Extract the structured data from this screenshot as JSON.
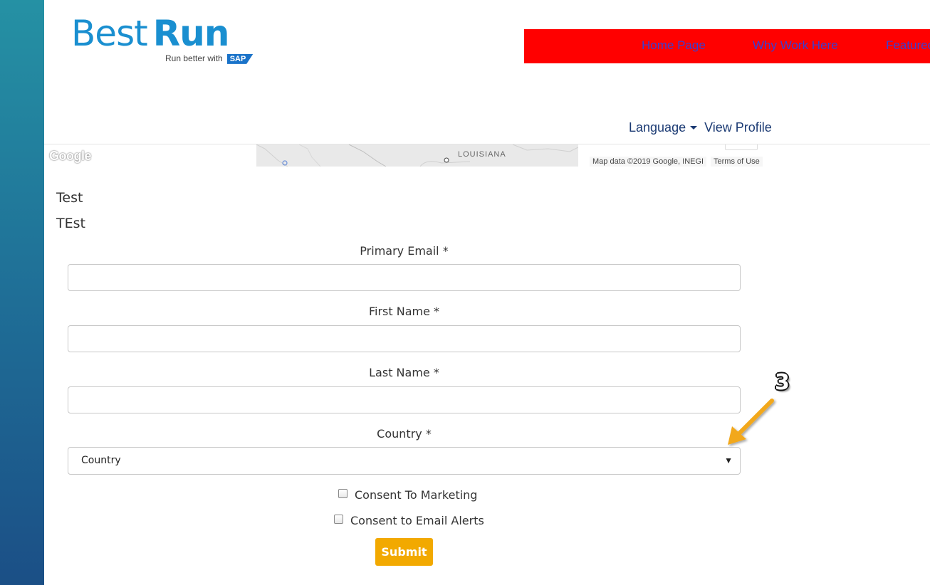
{
  "brand": {
    "logo_best": "Best",
    "logo_run": "Run",
    "tagline": "Run better with",
    "sap_badge": "SAP"
  },
  "nav": {
    "items": [
      "Home Page",
      "Why Work Here",
      "Featured"
    ]
  },
  "utility": {
    "language": "Language",
    "view_profile": "View Profile"
  },
  "map": {
    "logo": "Google",
    "state_label": "LOUISIANA",
    "attribution": "Map data ©2019 Google, INEGI",
    "terms": "Terms of Use"
  },
  "content": {
    "line1": "Test",
    "line2": "TEst"
  },
  "form": {
    "primary_email_label": "Primary Email *",
    "primary_email_value": "",
    "first_name_label": "First Name *",
    "first_name_value": "",
    "last_name_label": "Last Name *",
    "last_name_value": "",
    "country_label": "Country *",
    "country_selected": "Country",
    "consent_marketing_label": "Consent To Marketing",
    "consent_marketing_checked": false,
    "consent_email_label": "Consent to Email Alerts",
    "consent_email_checked": false,
    "submit_label": "Submit"
  },
  "annotation": {
    "step_number": "3"
  },
  "colors": {
    "nav_background": "#ff0000",
    "nav_link": "#3b3fd0",
    "submit": "#f2a900",
    "utility_text": "#1b3a73",
    "callout_arrow": "#f2a81e"
  }
}
